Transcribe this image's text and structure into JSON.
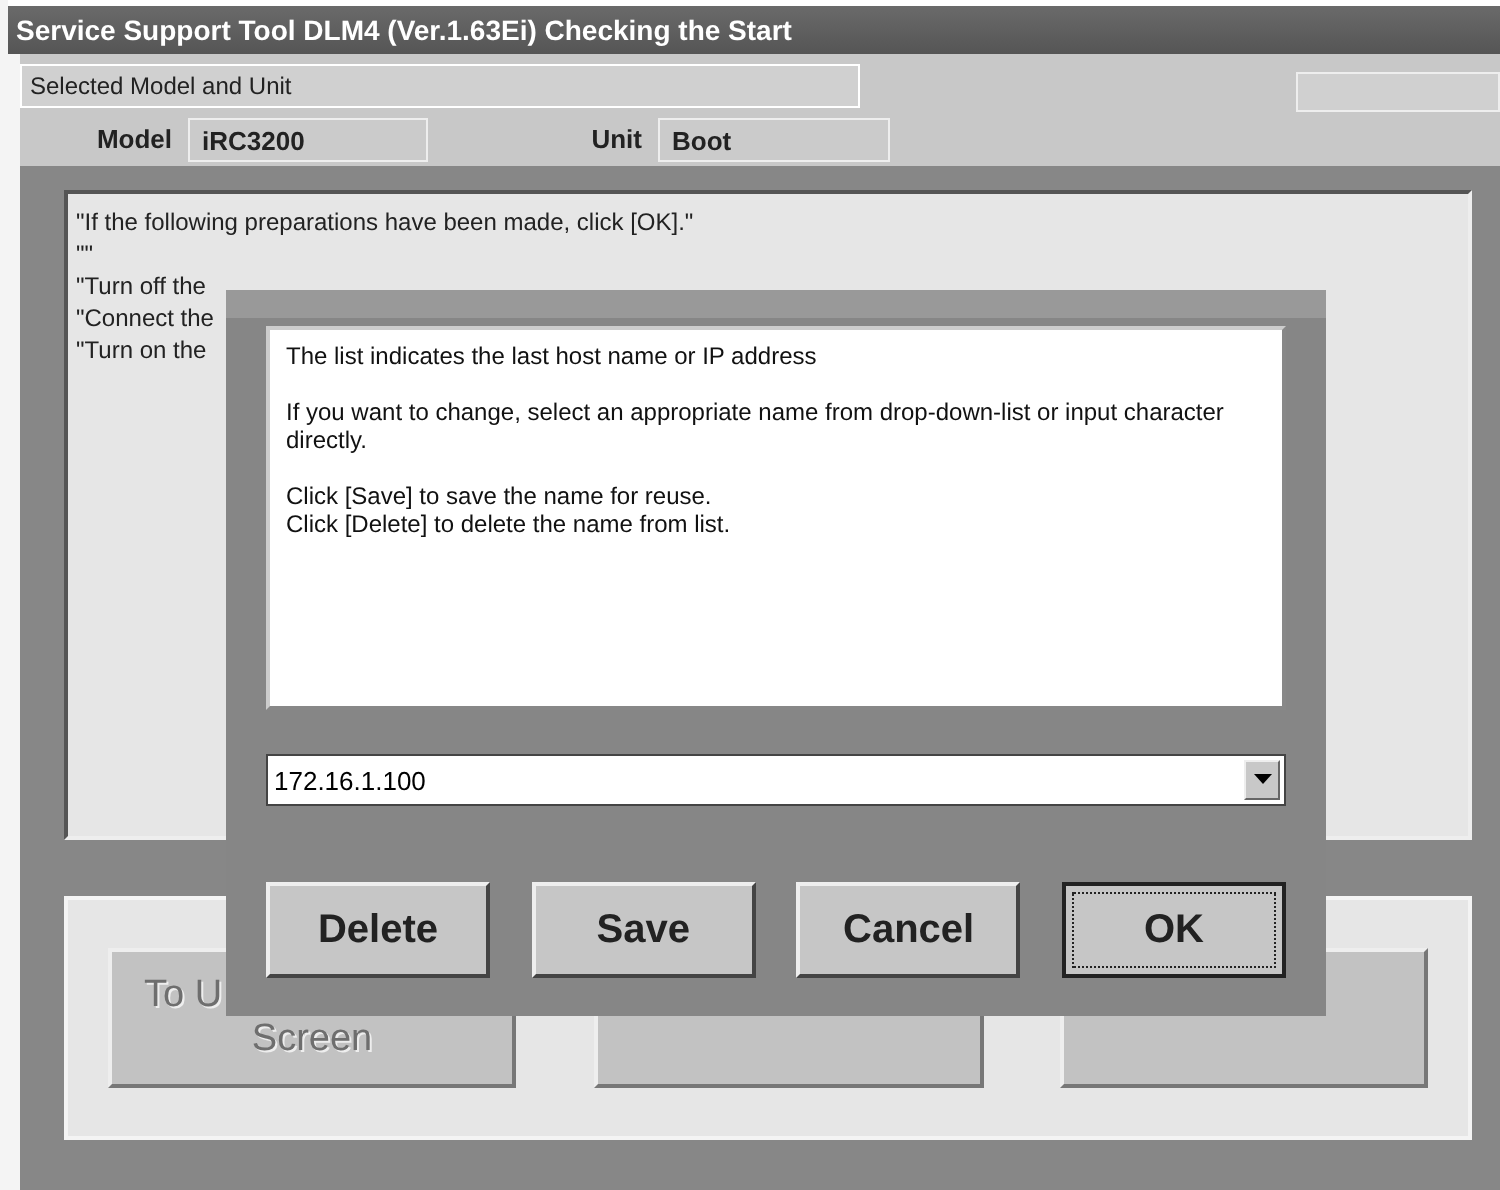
{
  "window": {
    "title": "Service Support Tool DLM4 (Ver.1.63Ei) Checking the Start"
  },
  "selection": {
    "heading": "Selected Model and Unit",
    "model_label": "Model",
    "model": "iRC3200",
    "unit_label": "Unit",
    "unit": "Boot"
  },
  "instructions": [
    "\"If the following preparations have been made, click [OK].\"",
    "\"\"",
    "\"Turn off the",
    "\"Connect the",
    "\"Turn on the"
  ],
  "main_buttons": [
    {
      "lines": [
        "To U",
        "Screen"
      ],
      "disabled": true
    },
    {
      "disabled": true
    },
    {
      "disabled": true
    }
  ],
  "dialog": {
    "message": [
      "The list indicates the last host name or IP address",
      "If you want to change, select an appropriate name from drop-down-list or input character directly.",
      "Click [Save] to save the name for reuse.\nClick [Delete] to delete the name from list."
    ],
    "host": {
      "value": "172.16.1.100"
    },
    "buttons": [
      {
        "label": "Delete",
        "focused": false
      },
      {
        "label": "Save",
        "focused": false
      },
      {
        "label": "Cancel",
        "focused": false
      },
      {
        "label": "OK",
        "focused": true
      }
    ]
  }
}
